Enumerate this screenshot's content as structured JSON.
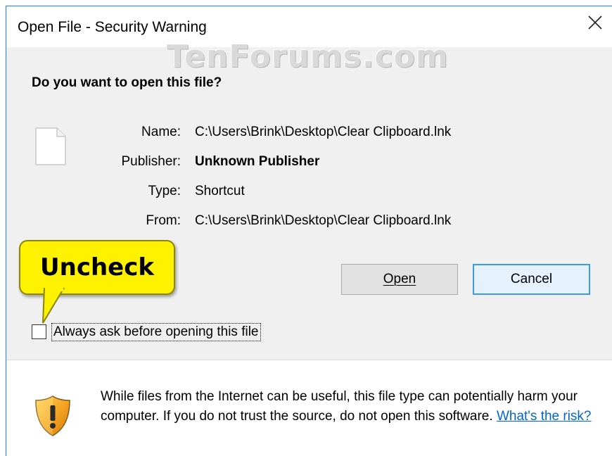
{
  "window": {
    "title": "Open File - Security Warning"
  },
  "watermark": "TenForums.com",
  "question": "Do you want to open this file?",
  "fields": [
    {
      "label": "Name:",
      "value": "C:\\Users\\Brink\\Desktop\\Clear Clipboard.lnk",
      "bold": false
    },
    {
      "label": "Publisher:",
      "value": "Unknown Publisher",
      "bold": true
    },
    {
      "label": "Type:",
      "value": "Shortcut",
      "bold": false
    },
    {
      "label": "From:",
      "value": "C:\\Users\\Brink\\Desktop\\Clear Clipboard.lnk",
      "bold": false
    }
  ],
  "buttons": {
    "open": "Open",
    "cancel": "Cancel"
  },
  "callout": "Uncheck",
  "checkbox": {
    "label": "Always ask before opening this file",
    "checked": false
  },
  "warning": {
    "text": "While files from the Internet can be useful, this file type can potentially harm your computer. If you do not trust the source, do not open this software. ",
    "link": "What's the risk?"
  },
  "colors": {
    "accent": "#1883d7",
    "callout": "#fff200",
    "link": "#0066cc",
    "shield": "#f5a623"
  },
  "icons": {
    "close": "close-icon",
    "file": "file-icon",
    "shield": "shield-warning-icon"
  }
}
